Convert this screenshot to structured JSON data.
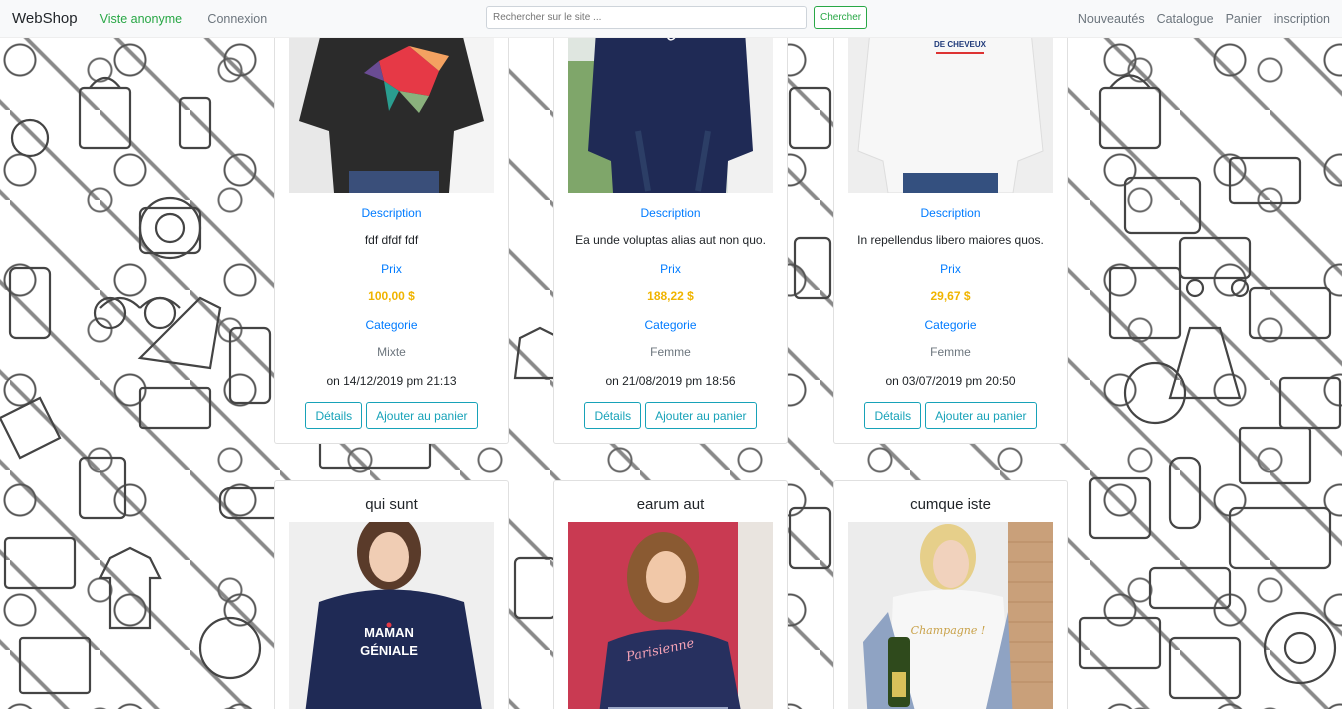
{
  "navbar": {
    "brand": "WebShop",
    "anon_link": "Viste anonyme",
    "login_link": "Connexion",
    "search_placeholder": "Rechercher sur le site ...",
    "search_button": "Chercher",
    "right_links": [
      "Nouveautés",
      "Catalogue",
      "Panier",
      "inscription"
    ]
  },
  "labels": {
    "description": "Description",
    "price": "Prix",
    "category": "Categorie",
    "details_button": "Détails",
    "add_to_cart_button": "Ajouter au panier"
  },
  "products_top": [
    {
      "description": "fdf dfdf fdf",
      "price": "100,00 $",
      "category": "Mixte",
      "date": "on 14/12/2019 pm 21:13",
      "shirt_color": "#2b2b2b",
      "print": "geometric-bear"
    },
    {
      "description": "Ea unde voluptas alias aut non quo.",
      "price": "188,22 $",
      "category": "Femme",
      "date": "on 21/08/2019 pm 18:56",
      "shirt_color": "#1f2a55",
      "print_text": "SALE GOSSE"
    },
    {
      "description": "In repellendus libero maiores quos.",
      "price": "29,67 $",
      "category": "Femme",
      "date": "on 03/07/2019 pm 20:50",
      "shirt_color": "#f2f2f2",
      "print_text": "PAS BESOIN DE CHEVEUX"
    }
  ],
  "products_bottom": [
    {
      "title": "qui sunt",
      "shirt_color": "#1f2a55",
      "print_text": "MAMAN GÉNIALE",
      "bg": "#f0f0f0"
    },
    {
      "title": "earum aut",
      "shirt_color": "#27305f",
      "print_text": "Parisienne",
      "bg": "#c93a52"
    },
    {
      "title": "cumque iste",
      "shirt_color": "#f5f5f5",
      "print_text": "Champagne !",
      "bg": "#d8b89a"
    }
  ]
}
